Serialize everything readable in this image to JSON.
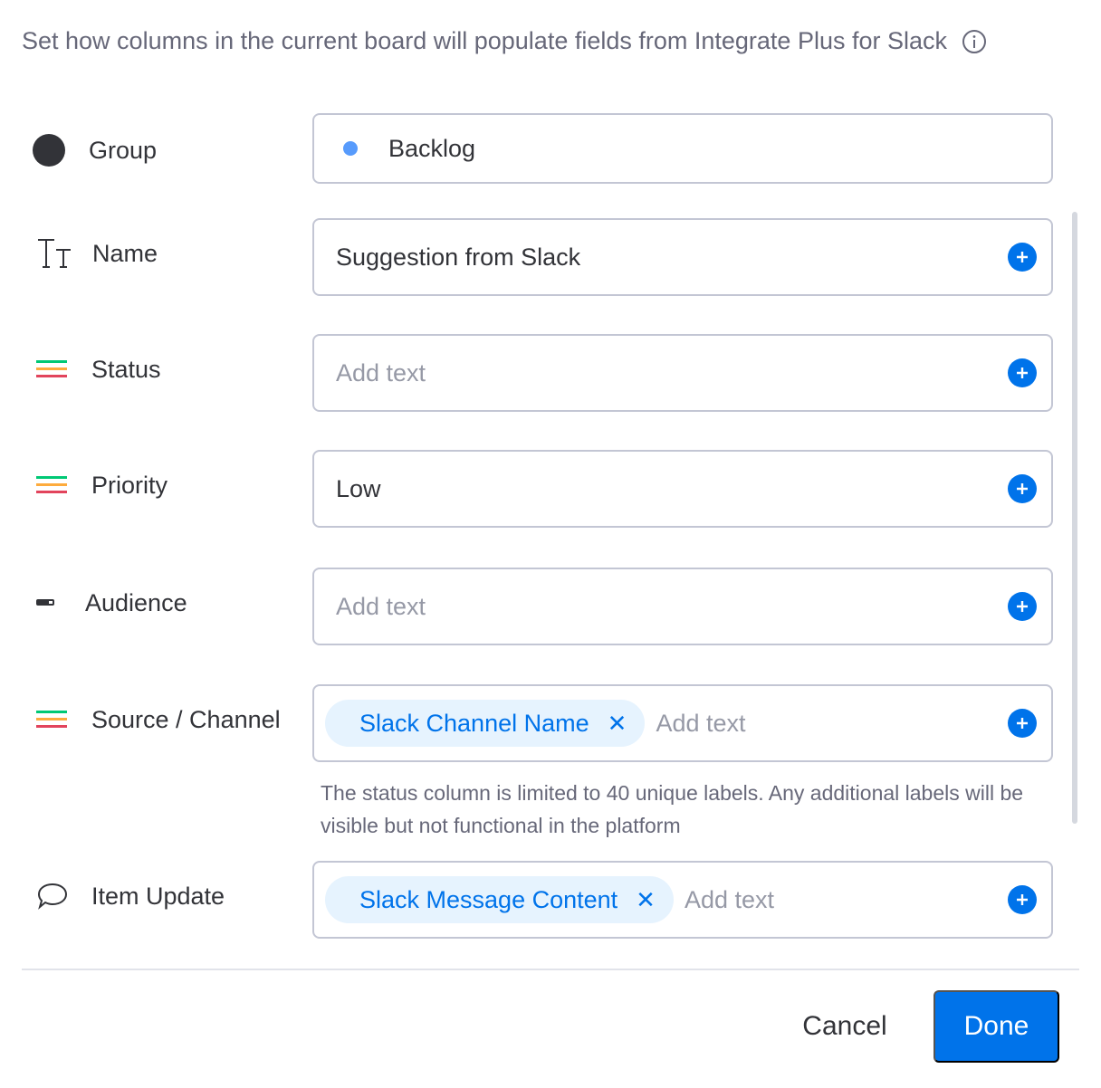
{
  "header": {
    "subtitle": "Set how columns in the current board will populate fields from Integrate Plus for Slack",
    "info_icon": "info-circle-icon"
  },
  "rows": [
    {
      "label": "Group",
      "icon": "group-dot-icon",
      "value": "Backlog",
      "value_dot_color": "#579bfc"
    },
    {
      "label": "Name",
      "icon": "text-type-icon",
      "value": "Suggestion from Slack"
    },
    {
      "label": "Status",
      "icon": "status-lines-icon",
      "placeholder": "Add text"
    },
    {
      "label": "Priority",
      "icon": "status-lines-icon",
      "value": "Low"
    },
    {
      "label": "Audience",
      "icon": "dropdown-dash-icon",
      "placeholder": "Add text"
    },
    {
      "label": "Source / Channel",
      "icon": "status-lines-icon",
      "chip": "Slack Channel Name",
      "placeholder": "Add text"
    },
    {
      "label": "Item Update",
      "icon": "speech-bubble-icon",
      "chip": "Slack Message Content",
      "placeholder": "Add text"
    }
  ],
  "hint": "The status column is limited to 40 unique labels. Any additional labels will be visible but not functional in the platform",
  "footer": {
    "cancel_label": "Cancel",
    "done_label": "Done"
  },
  "colors": {
    "accent": "#0073ea",
    "chip_bg": "#e6f3fe",
    "status_lines": [
      "#00c875",
      "#fdab3d",
      "#e2445c"
    ]
  }
}
